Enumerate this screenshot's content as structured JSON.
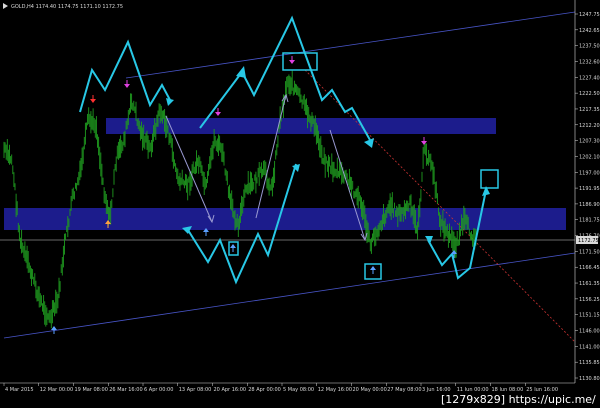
{
  "window": {
    "symbol_title": "GOLD,H4  1174.40  1174.75  1171.10  1172.75"
  },
  "price_axis": {
    "labels": [
      "1247.75",
      "1242.65",
      "1237.50",
      "1232.60",
      "1227.40",
      "1222.50",
      "1217.35",
      "1212.20",
      "1207.30",
      "1202.10",
      "1197.00",
      "1191.95",
      "1186.90",
      "1181.75",
      "1176.70",
      "1171.50",
      "1166.45",
      "1161.35",
      "1156.25",
      "1151.15",
      "1146.00",
      "1141.00",
      "1135.85",
      "1130.80"
    ],
    "current_price": "1172.75"
  },
  "time_axis": {
    "labels": [
      "4 Mar 2015",
      "12 Mar 00:00",
      "19 Mar 08:00",
      "26 Mar 16:00",
      "6 Apr 00:00",
      "13 Apr 08:00",
      "20 Apr 16:00",
      "28 Apr 00:00",
      "5 May 08:00",
      "12 May 16:00",
      "20 May 00:00",
      "27 May 08:00",
      "3 Jun 16:00",
      "11 Jun 00:00",
      "18 Jun 08:00",
      "25 Jun 16:00"
    ]
  },
  "watermark": "[1279x829] https://upic.me/",
  "colors": {
    "background": "#000000",
    "candles": "#1f9b1f",
    "zigzag": "#28c8e6",
    "channel": "#4855c8",
    "zone": "#1c1c8c",
    "trend_dotted": "#c83232",
    "projection": "#9a9ad2",
    "price_line": "#8a8a8a",
    "arrow_up_blue": "#5aa0ff",
    "arrow_down_red": "#ff3030",
    "arrow_down_magenta": "#e040e0",
    "arrow_up_orange": "#ffa040"
  }
}
